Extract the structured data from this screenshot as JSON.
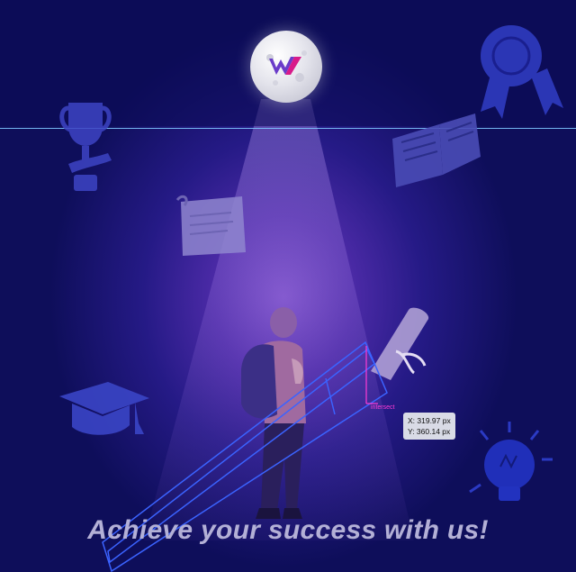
{
  "tagline": "Achieve your success with us!",
  "logo": {
    "letter": "W",
    "icon": "brand-moon-logo-icon"
  },
  "measurement": {
    "x_label": "X: 319.97 px",
    "y_label": "Y: 360.14 px",
    "intersect_label": "intersect"
  },
  "icons": [
    "trophy-icon",
    "award-ribbon-icon",
    "open-book-icon",
    "paper-scroll-icon",
    "diploma-scroll-icon",
    "graduation-cap-icon",
    "lightbulb-icon",
    "student-figure"
  ],
  "colors": {
    "background": "#0e0e5a",
    "glow": "#7a4fc7",
    "guide": "#7ec8ff",
    "selection": "#3b63ff",
    "measure": "#ff3bd4",
    "tagline": "#b3b0d6"
  }
}
